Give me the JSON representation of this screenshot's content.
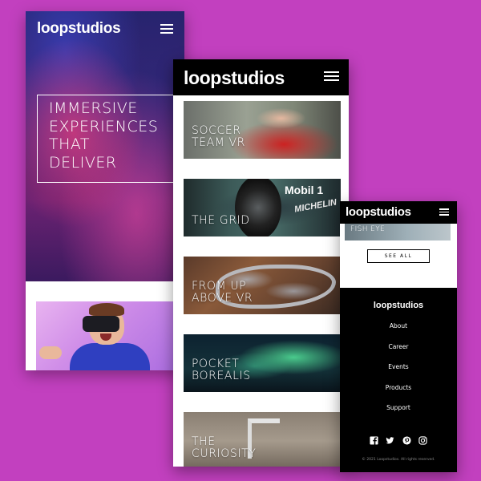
{
  "colors": {
    "background": "#c240bf",
    "header_bg": "#000000",
    "text_light": "#ffffff"
  },
  "screen_mobile_home": {
    "logo": "loopstudios",
    "menu_icon": "hamburger-icon",
    "headline_lines": [
      "IMMERSIVE",
      "EXPERIENCES",
      "THAT",
      "DELIVER"
    ]
  },
  "screen_mobile_creations": {
    "logo": "loopstudios",
    "menu_icon": "hamburger-icon",
    "cards": [
      {
        "title_lines": [
          "SOCCER",
          "TEAM VR"
        ]
      },
      {
        "title_lines": [
          "THE GRID",
          ""
        ]
      },
      {
        "title_lines": [
          "FROM UP",
          "ABOVE VR"
        ]
      },
      {
        "title_lines": [
          "POCKET",
          "BOREALIS"
        ]
      },
      {
        "title_lines": [
          "THE",
          "CURIOSITY"
        ]
      }
    ],
    "card2_brand_text": [
      "Mobil 1",
      "MICHELIN"
    ]
  },
  "screen_mobile_footer": {
    "logo": "loopstudios",
    "menu_icon": "hamburger-icon",
    "partial_card_title": "FISH EYE",
    "see_all_label": "SEE ALL",
    "footer_logo": "loopstudios",
    "nav_items": [
      "About",
      "Career",
      "Events",
      "Products",
      "Support"
    ],
    "social_icons": [
      "facebook-icon",
      "twitter-icon",
      "pinterest-icon",
      "instagram-icon"
    ],
    "copyright": "© 2021 Loopstudios. All rights reserved."
  }
}
